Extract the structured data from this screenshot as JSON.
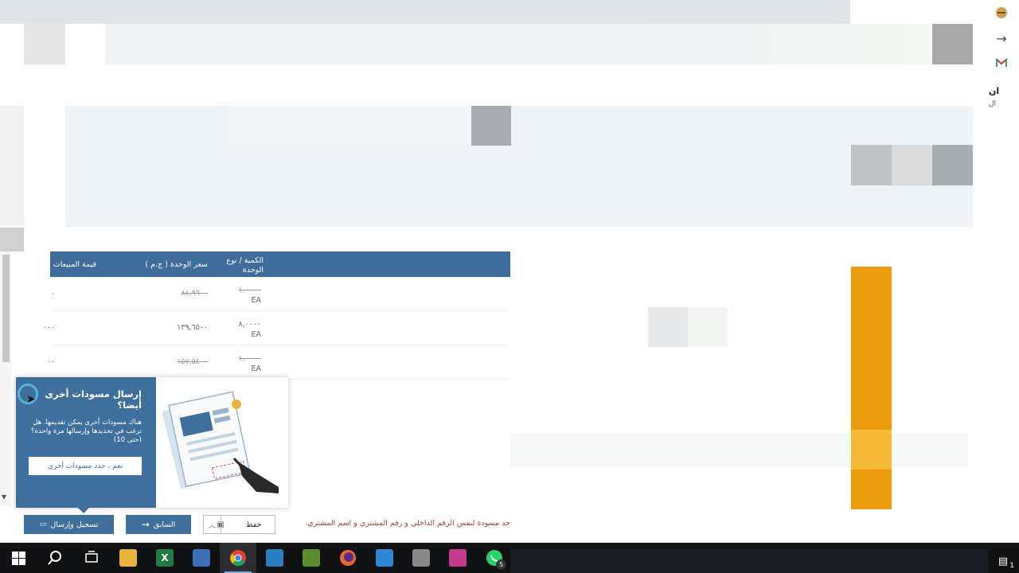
{
  "table": {
    "headers": {
      "qty": "الكمية / نوع الوحدة",
      "unit_price": "سعر الوحدة ( ج.م )",
      "sales_value": "قيمة المبيعات"
    },
    "rows": [
      {
        "qty": "١,٠٠٠٠",
        "unit": "EA",
        "price": "٨٤,٩٦٠٠",
        "value": "٠",
        "struck": true
      },
      {
        "qty": "٨,٠٠٠٠",
        "unit": "EA",
        "price": "١٣٩,٦٥٠٠",
        "value": "٠٠٠",
        "struck": false
      },
      {
        "qty": "١,٠٠٠٠",
        "unit": "EA",
        "price": "١٥٧,٥٤٠٠",
        "value": "٠٠",
        "struck": true
      }
    ]
  },
  "popup": {
    "title": "إرسال مسودات أخرى أيضا؟",
    "body": "هناك مسودات أخرى يمكن تقديمها. هل ترغب في تحديدها وإرسالها مرة واحدة؟ (حتى 10)",
    "button": "نعم ، حدد مسودات أخرى"
  },
  "actions": {
    "submit": "تسجيل وإرسال",
    "previous": "السابق",
    "save": "حفظ",
    "warning": "جد مسودة لنفس الرقم الداخلي و رقم المشتري و اسم المشتري."
  },
  "right_edge": {
    "text": "ان",
    "small": "ال"
  },
  "taskbar": {
    "items": [
      {
        "name": "windows-start",
        "icon": "windows-logo-icon"
      },
      {
        "name": "search",
        "icon": "search-icon"
      },
      {
        "name": "task-view",
        "icon": "task-view-icon"
      },
      {
        "name": "file-explorer",
        "icon": "folder-icon",
        "color": "#e8b33c"
      },
      {
        "name": "excel",
        "icon": "excel-icon",
        "color": "#1f7a43",
        "label": "X"
      },
      {
        "name": "outlook",
        "icon": "outlook-icon",
        "color": "#3b6fb6"
      },
      {
        "name": "chrome",
        "icon": "chrome-icon",
        "color": "#e34133",
        "active": true
      },
      {
        "name": "app-blue",
        "icon": "window-icon",
        "color": "#2a7fc1"
      },
      {
        "name": "app-green",
        "icon": "plant-icon",
        "color": "#5a8d2d"
      },
      {
        "name": "firefox",
        "icon": "firefox-icon",
        "color": "#e8692e"
      },
      {
        "name": "app-installer",
        "icon": "installer-icon",
        "color": "#2f86d6"
      },
      {
        "name": "app-gray",
        "icon": "image-icon",
        "color": "#888888"
      },
      {
        "name": "app-drop",
        "icon": "drop-icon",
        "color": "#c43b8c"
      },
      {
        "name": "whatsapp",
        "icon": "whatsapp-icon",
        "color": "#25d366",
        "badge": "5"
      }
    ],
    "notification_badge": "1"
  },
  "colors": {
    "header_blue": "#3e6d9b",
    "orange": "#ec9a0f",
    "warning_red": "#b03a3a"
  }
}
